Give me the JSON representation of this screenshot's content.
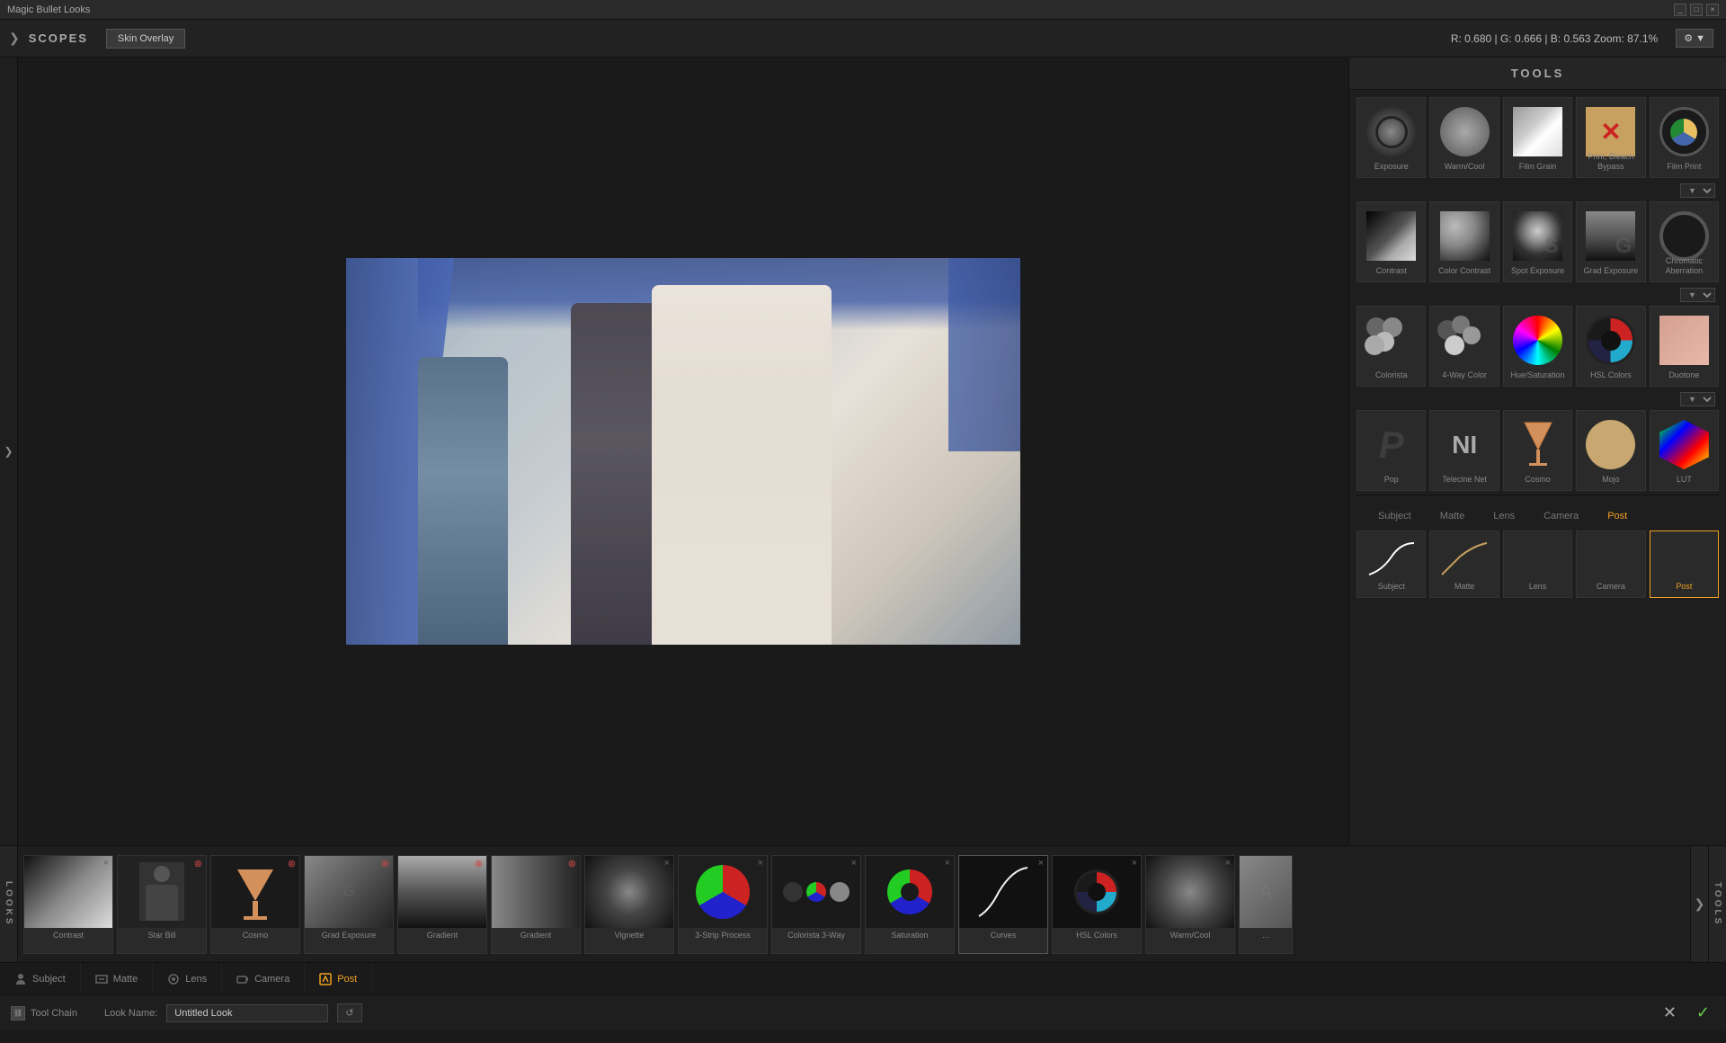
{
  "titlebar": {
    "title": "Magic Bullet Looks",
    "minimize": "_",
    "maximize": "□",
    "close": "×"
  },
  "topbar": {
    "nav_arrow": "❯",
    "scopes_label": "SCOPES",
    "skin_overlay": "Skin Overlay",
    "color_info": "R: 0.680 | G: 0.666 | B: 0.563   Zoom: 87.1%",
    "gear_label": "⚙"
  },
  "tools": {
    "header": "TOOLS",
    "rows": [
      [
        {
          "name": "Exposure",
          "id": "exposure"
        },
        {
          "name": "Warm/Cool",
          "id": "warm-cool"
        },
        {
          "name": "Film Grain",
          "id": "film-grain"
        },
        {
          "name": "Print, Bleach Bypass",
          "id": "print-bleach"
        },
        {
          "name": "Film Print",
          "id": "film-print"
        }
      ],
      [
        {
          "name": "Contrast",
          "id": "contrast"
        },
        {
          "name": "Color Contrast",
          "id": "color-contrast"
        },
        {
          "name": "Spot Exposure",
          "id": "spot-exposure"
        },
        {
          "name": "Grad Exposure",
          "id": "grad-exposure"
        },
        {
          "name": "Chromatic Aberration",
          "id": "chromatic"
        }
      ],
      [
        {
          "name": "Colorista",
          "id": "colorista"
        },
        {
          "name": "4-Way Color",
          "id": "4way-color"
        },
        {
          "name": "Hue/Saturation",
          "id": "hue-sat"
        },
        {
          "name": "HSL Colors",
          "id": "hsl-colors"
        },
        {
          "name": "Duotone",
          "id": "duotone"
        }
      ],
      [
        {
          "name": "Pop",
          "id": "pop"
        },
        {
          "name": "Telecine Net",
          "id": "telecine"
        },
        {
          "name": "Cosmo",
          "id": "cosmo"
        },
        {
          "name": "Mojo",
          "id": "mojo"
        },
        {
          "name": "LUT",
          "id": "lut"
        }
      ]
    ]
  },
  "section_tabs": {
    "tabs": [
      "Subject",
      "Matte",
      "Lens",
      "Camera",
      "Post"
    ],
    "active": "Post"
  },
  "looks_strip": {
    "label": "LOOKS",
    "items": [
      {
        "name": "Contrast",
        "id": "contrast-look",
        "closeable": true,
        "close_type": "x"
      },
      {
        "name": "Star Bill",
        "id": "star-bill",
        "closeable": true,
        "close_type": "red"
      },
      {
        "name": "Cosmo",
        "id": "cosmo-look",
        "closeable": true,
        "close_type": "red"
      },
      {
        "name": "Grad Exposure",
        "id": "grad-exp-look",
        "closeable": true,
        "close_type": "red"
      },
      {
        "name": "Gradient",
        "id": "gradient-look",
        "closeable": true,
        "close_type": "red"
      },
      {
        "name": "Gradient",
        "id": "gradient2-look",
        "closeable": true,
        "close_type": "red"
      },
      {
        "name": "Vignette",
        "id": "vignette-look",
        "closeable": true,
        "close_type": "x"
      },
      {
        "name": "3-Strip Process",
        "id": "3strip-look",
        "closeable": true,
        "close_type": "x"
      },
      {
        "name": "Colorista 3-Way",
        "id": "colorista3-look",
        "closeable": true,
        "close_type": "x"
      },
      {
        "name": "Saturation",
        "id": "saturation-look",
        "closeable": true,
        "close_type": "x"
      },
      {
        "name": "Curves",
        "id": "curves-look",
        "closeable": true,
        "close_type": "x"
      },
      {
        "name": "HSL Colors",
        "id": "hsl-look",
        "closeable": true,
        "close_type": "x"
      },
      {
        "name": "Warm/Cool",
        "id": "warm-cool-look",
        "closeable": true,
        "close_type": "x"
      },
      {
        "name": "...",
        "id": "partial-look",
        "closeable": false,
        "close_type": "none"
      }
    ]
  },
  "stage_sections": [
    {
      "name": "Subject",
      "active": false,
      "icon": "person"
    },
    {
      "name": "Matte",
      "active": false,
      "icon": "matte"
    },
    {
      "name": "Lens",
      "active": false,
      "icon": "lens"
    },
    {
      "name": "Camera",
      "active": false,
      "icon": "camera"
    },
    {
      "name": "Post",
      "active": true,
      "icon": "post"
    }
  ],
  "bottom_toolbar": {
    "tool_chain_label": "Tool Chain",
    "look_name_label": "Look Name:",
    "look_name_value": "Untitled Look",
    "reset_icon": "↺",
    "cancel": "✕",
    "ok": "✓"
  }
}
